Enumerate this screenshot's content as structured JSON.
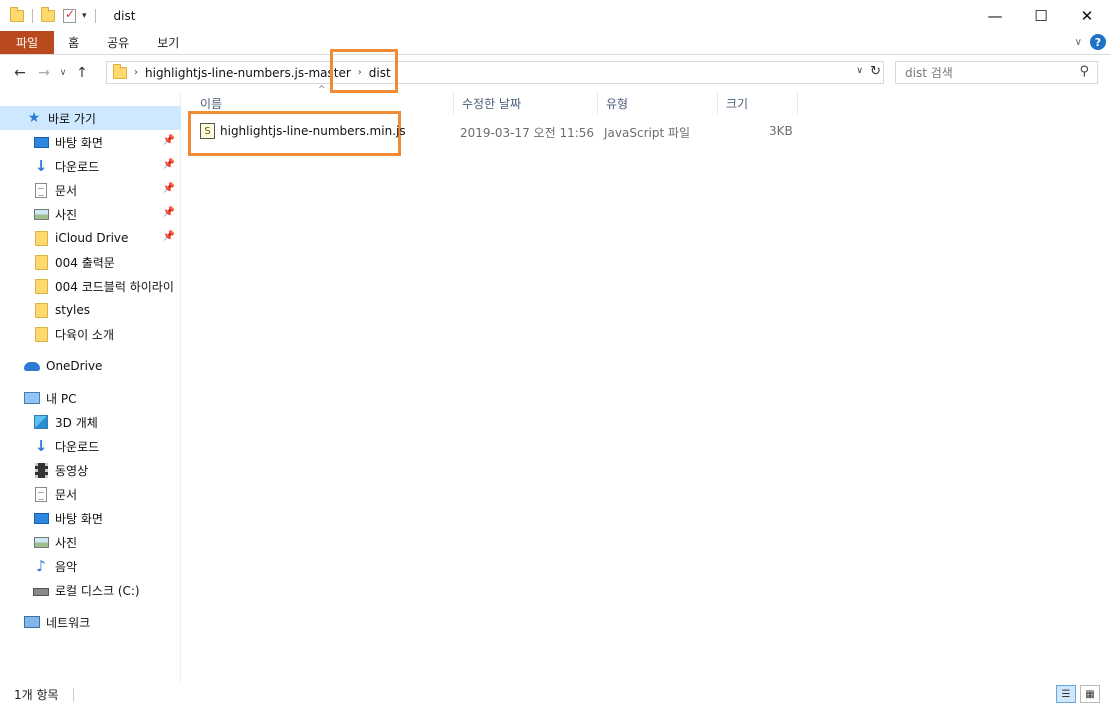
{
  "window": {
    "title": "dist",
    "controls": {
      "minimize": "—",
      "maximize": "☐",
      "close": "✕"
    }
  },
  "ribbon": {
    "tabs": [
      "파일",
      "홈",
      "공유",
      "보기"
    ],
    "help": "?",
    "collapse": "∨"
  },
  "nav": {
    "back": "←",
    "forward": "→",
    "recent": "∨",
    "up": "↑"
  },
  "address": {
    "crumbs": [
      "highlightjs-line-numbers.js-master",
      "dist"
    ],
    "separator": "›",
    "dropdown": "∨",
    "refresh": "↻"
  },
  "search": {
    "placeholder": "dist 검색",
    "icon": "⚲"
  },
  "sidebar": {
    "quick_access": {
      "label": "바로 가기",
      "icon": "star-icon"
    },
    "quick_items": [
      {
        "label": "바탕 화면",
        "icon": "desktop-icon",
        "pinned": true
      },
      {
        "label": "다운로드",
        "icon": "download-icon",
        "pinned": true
      },
      {
        "label": "문서",
        "icon": "document-icon",
        "pinned": true
      },
      {
        "label": "사진",
        "icon": "picture-icon",
        "pinned": true
      },
      {
        "label": "iCloud Drive",
        "icon": "folder-icon",
        "pinned": true
      },
      {
        "label": "004 출력문",
        "icon": "folder-icon",
        "pinned": false
      },
      {
        "label": "004 코드블럭 하이라이",
        "icon": "folder-icon",
        "pinned": false
      },
      {
        "label": "styles",
        "icon": "folder-icon",
        "pinned": false
      },
      {
        "label": "다육이 소개",
        "icon": "folder-icon",
        "pinned": false
      }
    ],
    "onedrive": {
      "label": "OneDrive",
      "icon": "cloud-icon"
    },
    "this_pc": {
      "label": "내 PC",
      "icon": "computer-icon"
    },
    "pc_items": [
      {
        "label": "3D 개체",
        "icon": "3d-objects-icon"
      },
      {
        "label": "다운로드",
        "icon": "download-icon"
      },
      {
        "label": "동영상",
        "icon": "video-icon"
      },
      {
        "label": "문서",
        "icon": "document-icon"
      },
      {
        "label": "바탕 화면",
        "icon": "desktop-icon"
      },
      {
        "label": "사진",
        "icon": "picture-icon"
      },
      {
        "label": "음악",
        "icon": "music-icon"
      },
      {
        "label": "로컬 디스크 (C:)",
        "icon": "drive-icon"
      }
    ],
    "network": {
      "label": "네트워크",
      "icon": "network-icon"
    }
  },
  "table": {
    "columns": [
      "이름",
      "수정한 날짜",
      "유형",
      "크기"
    ],
    "sort_indicator": "^",
    "rows": [
      {
        "name": "highlightjs-line-numbers.min.js",
        "modified": "2019-03-17 오전 11:56",
        "type": "JavaScript 파일",
        "size": "3KB"
      }
    ]
  },
  "status": {
    "item_count": "1개 항목"
  },
  "accent": {
    "file_tab": "#b94a1e",
    "highlight": "#f08a34",
    "selection": "#cde8ff"
  }
}
